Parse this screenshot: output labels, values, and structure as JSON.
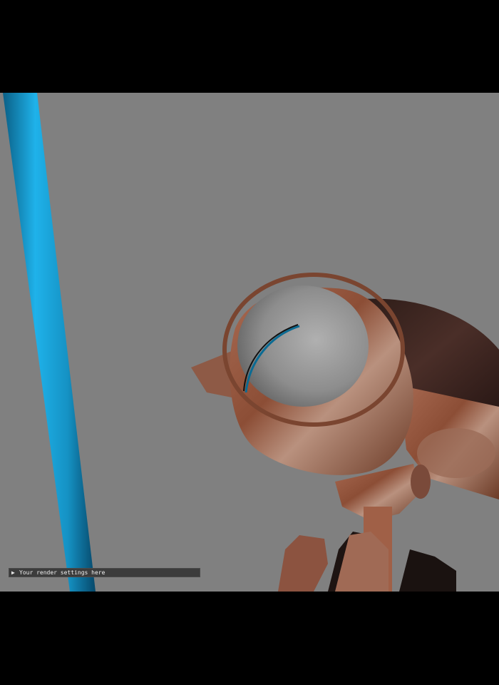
{
  "render_settings": {
    "toggle_glyph": "▶",
    "label": "Your render settings here",
    "expanded": false
  },
  "scene": {
    "background_color": "#808080",
    "pole_color": "#1aa0d6",
    "robot_rust_color": "#9a5a40",
    "lens_color": "#9a9a9a",
    "body_dark_color": "#3a2420"
  }
}
